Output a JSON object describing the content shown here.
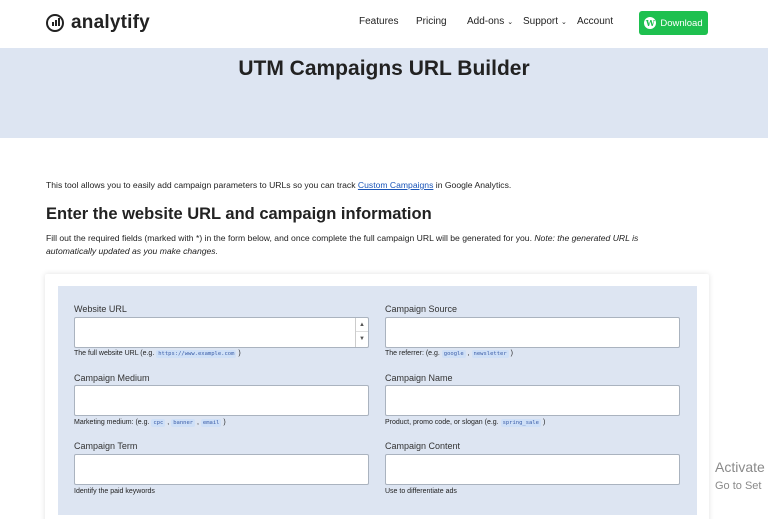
{
  "header": {
    "logo_text": "analytify",
    "nav": {
      "features": "Features",
      "pricing": "Pricing",
      "addons": "Add-ons",
      "support": "Support",
      "account": "Account"
    },
    "download_label": "Download",
    "accent_color": "#1ec04f"
  },
  "banner": {
    "title": "UTM Campaigns URL Builder",
    "background": "#dde5f2"
  },
  "intro": {
    "before": "This tool allows you to easily add campaign parameters to URLs so you can track ",
    "link": "Custom Campaigns",
    "after": " in Google Analytics."
  },
  "section": {
    "title": "Enter the website URL and campaign information",
    "desc_plain": "Fill out the required fields (marked with *) in the form below, and once complete the full campaign URL will be generated for you. ",
    "desc_note": "Note: the generated URL is automatically updated as you make changes."
  },
  "form": {
    "website_url": {
      "label": "Website URL",
      "value": "",
      "help_before": "The full website URL (e.g. ",
      "help_code1": "https://www.example.com",
      "help_after": " )"
    },
    "campaign_source": {
      "label": "Campaign Source",
      "value": "",
      "help_before": "The referrer: (e.g. ",
      "help_code1": "google",
      "help_sep1": " , ",
      "help_code2": "newsletter",
      "help_after": " )"
    },
    "campaign_medium": {
      "label": "Campaign Medium",
      "value": "",
      "help_before": "Marketing medium: (e.g. ",
      "help_code1": "cpc",
      "help_sep1": " , ",
      "help_code2": "banner",
      "help_sep2": " , ",
      "help_code3": "email",
      "help_after": " )"
    },
    "campaign_name": {
      "label": "Campaign Name",
      "value": "",
      "help_before": "Product, promo code, or slogan (e.g. ",
      "help_code1": "spring_sale",
      "help_after": " )"
    },
    "campaign_term": {
      "label": "Campaign Term",
      "value": "",
      "help": "Identify the paid keywords"
    },
    "campaign_content": {
      "label": "Campaign Content",
      "value": "",
      "help": "Use to differentiate ads"
    }
  },
  "watermark": {
    "line1": "Activate",
    "line2": "Go to Set"
  }
}
